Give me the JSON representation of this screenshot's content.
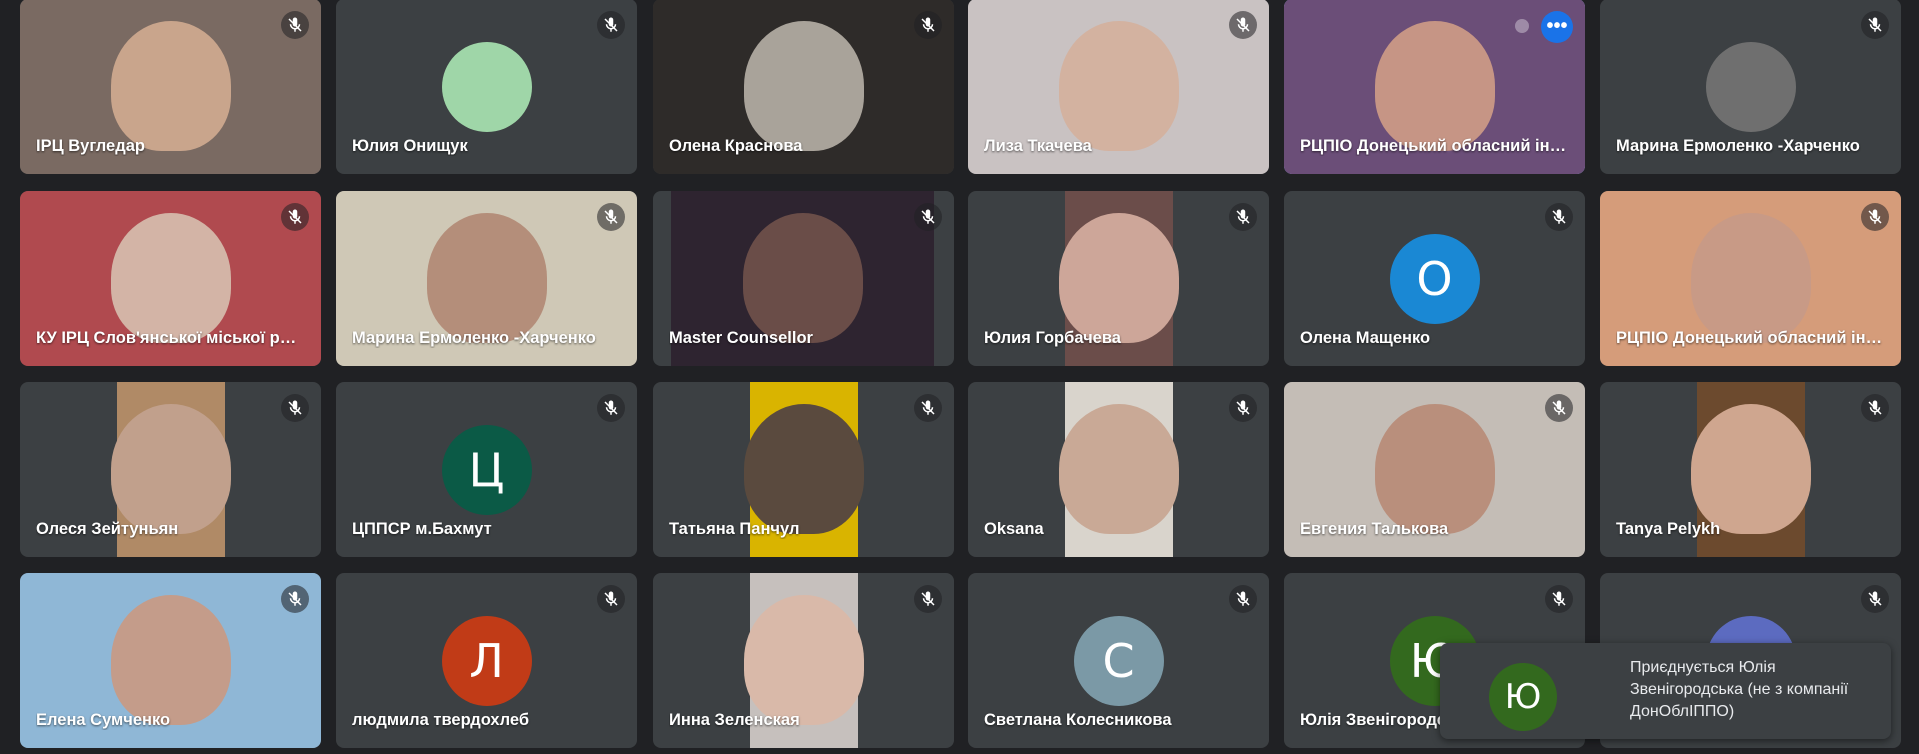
{
  "tiles": [
    {
      "name": "ІРЦ Вугледар",
      "kind": "video",
      "bg": "#7a6a62",
      "glow": "#c9a58c"
    },
    {
      "name": "Юлия Онищук",
      "kind": "avatar",
      "avatar_text": "",
      "avatar_color": "#9fd6a8"
    },
    {
      "name": "Олена Краснова",
      "kind": "video",
      "bg": "#2e2b29",
      "glow": "#a9a39a"
    },
    {
      "name": "Лиза Ткачева",
      "kind": "video",
      "bg": "#c9c2c2",
      "glow": "#d3b2a0"
    },
    {
      "name": "РЦПІО Донецький обласний інститут",
      "kind": "video",
      "bg": "#6b4e78",
      "glow": "#c69585",
      "active": true
    },
    {
      "name": "Марина Ермоленко -Харченко",
      "kind": "avatar",
      "avatar_text": "",
      "avatar_color": "#6f6f6f"
    },
    {
      "name": "КУ ІРЦ Слов'янської міської ради",
      "kind": "video",
      "bg": "#b04a4f",
      "glow": "#d3b4a6"
    },
    {
      "name": "Марина Ермоленко -Харченко",
      "kind": "video",
      "bg": "#cfc8b6",
      "glow": "#b48e7a"
    },
    {
      "name": "Master Counsellor",
      "kind": "video",
      "bg": "#2e2430",
      "glow": "#6a4d48",
      "narrow": "mid"
    },
    {
      "name": "Юлия Горбачева",
      "kind": "video",
      "bg": "#6b4d4a",
      "glow": "#cda699",
      "narrow": "narrow"
    },
    {
      "name": "Олена Мащенко",
      "kind": "avatar",
      "avatar_text": "О",
      "avatar_color": "#1a88d4"
    },
    {
      "name": "РЦПІО Донецький обласний інститут",
      "kind": "video",
      "bg": "#d59c7a",
      "glow": "#c89a86"
    },
    {
      "name": "Олеся Зейтуньян",
      "kind": "video",
      "bg": "#b08a66",
      "glow": "#c1a08c",
      "narrow": "narrow"
    },
    {
      "name": "ЦППСР м.Бахмут",
      "kind": "avatar",
      "avatar_text": "Ц",
      "avatar_color": "#0b5a46"
    },
    {
      "name": "Татьяна Панчул",
      "kind": "video",
      "bg": "#d9b400",
      "glow": "#5a4a3e",
      "narrow": "narrow"
    },
    {
      "name": "Oksana",
      "kind": "video",
      "bg": "#d9d4cc",
      "glow": "#c9a996",
      "narrow": "narrow"
    },
    {
      "name": "Евгения Талькова",
      "kind": "video",
      "bg": "#c4bdb6",
      "glow": "#b98f7c"
    },
    {
      "name": "Tanya Pelykh",
      "kind": "video",
      "bg": "#6c4a2e",
      "glow": "#cfa68f",
      "narrow": "narrow"
    },
    {
      "name": "Елена Сумченко",
      "kind": "video",
      "bg": "#8fb7d6",
      "glow": "#c49c8a"
    },
    {
      "name": "людмила твердохлеб",
      "kind": "avatar",
      "avatar_text": "Л",
      "avatar_color": "#c13b17"
    },
    {
      "name": "Инна Зеленская",
      "kind": "video",
      "bg": "#c6c0bd",
      "glow": "#d9b9a9",
      "narrow": "narrow"
    },
    {
      "name": "Светлана Колесникова",
      "kind": "avatar",
      "avatar_text": "С",
      "avatar_color": "#7b99a6"
    },
    {
      "name": "Юлія Звенігородська",
      "kind": "avatar",
      "avatar_text": "Ю",
      "avatar_color": "#33691e"
    },
    {
      "name": "",
      "kind": "avatar",
      "avatar_text": "",
      "avatar_color": "#5c6bc0"
    }
  ],
  "toast": {
    "avatar_text": "Ю",
    "avatar_color": "#33691e",
    "message": "Приєднується Юлія Звенігородська (не з компанії ДонОблІППО)"
  },
  "icons": {
    "mic": "mic-off-icon",
    "more": "more-options-icon"
  },
  "colors": {
    "background": "#202124",
    "tile": "#3c4043",
    "active_border": "#8ab4f8",
    "accent": "#1a73e8"
  }
}
